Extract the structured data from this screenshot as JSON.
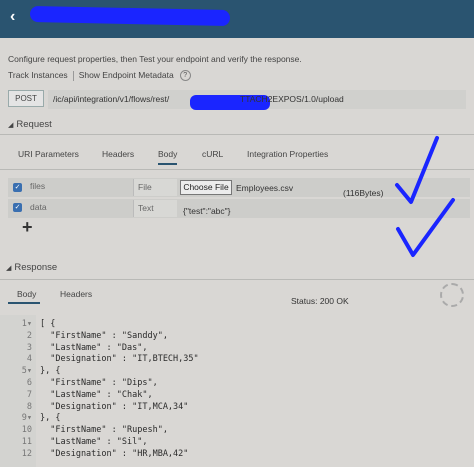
{
  "header": {
    "back_icon": "chevron-left-icon"
  },
  "description": "Configure request properties, then Test your endpoint and verify the response.",
  "links": {
    "track": "Track Instances",
    "metadata": "Show Endpoint Metadata",
    "help": "?"
  },
  "request_bar": {
    "method": "POST",
    "url_start": "/ic/api/integration/v1/flows/rest/",
    "url_end": "TTACH2EXPOS/1.0/upload"
  },
  "request": {
    "title": "Request",
    "tabs": [
      "URI Parameters",
      "Headers",
      "Body",
      "cURL",
      "Integration Properties"
    ],
    "active_tab": "Body",
    "rows": [
      {
        "name": "files",
        "type": "File",
        "button": "Choose File",
        "value": "Employees.csv",
        "size": "(116Bytes)"
      },
      {
        "name": "data",
        "type": "Text",
        "value": "{\"test\":\"abc\"}"
      }
    ],
    "add": "+"
  },
  "response": {
    "title": "Response",
    "tabs": [
      "Body",
      "Headers"
    ],
    "active_tab": "Body",
    "status": "Status: 200 OK",
    "lines": [
      {
        "n": "1",
        "fold": true,
        "text": "[ {"
      },
      {
        "n": "2",
        "fold": false,
        "text": "  \"FirstName\" : \"Sanddy\","
      },
      {
        "n": "3",
        "fold": false,
        "text": "  \"LastName\" : \"Das\","
      },
      {
        "n": "4",
        "fold": false,
        "text": "  \"Designation\" : \"IT,BTECH,35\""
      },
      {
        "n": "5",
        "fold": true,
        "text": "}, {"
      },
      {
        "n": "6",
        "fold": false,
        "text": "  \"FirstName\" : \"Dips\","
      },
      {
        "n": "7",
        "fold": false,
        "text": "  \"LastName\" : \"Chak\","
      },
      {
        "n": "8",
        "fold": false,
        "text": "  \"Designation\" : \"IT,MCA,34\""
      },
      {
        "n": "9",
        "fold": true,
        "text": "}, {"
      },
      {
        "n": "10",
        "fold": false,
        "text": "  \"FirstName\" : \"Rupesh\","
      },
      {
        "n": "11",
        "fold": false,
        "text": "  \"LastName\" : \"Sil\","
      },
      {
        "n": "12",
        "fold": false,
        "text": "  \"Designation\" : \"HR,MBA,42\""
      }
    ]
  },
  "colors": {
    "header": "#2a5470",
    "annotation": "#1a25ff",
    "checkbox": "#3a6fb0"
  }
}
